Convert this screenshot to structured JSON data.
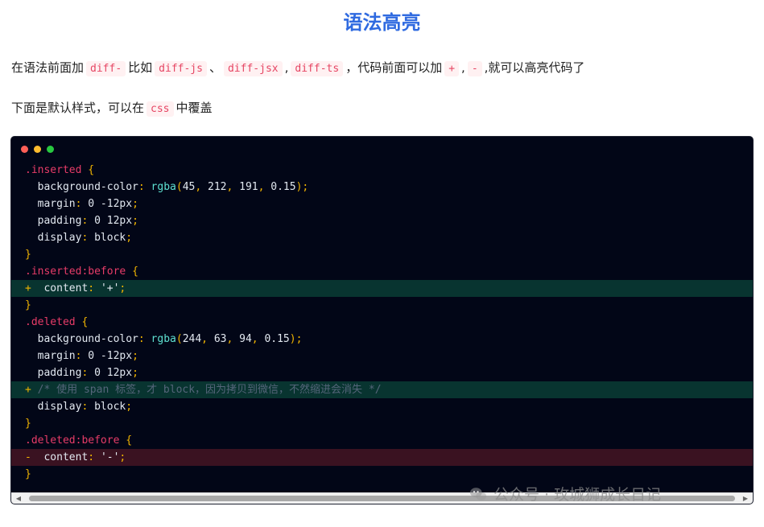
{
  "title": "语法高亮",
  "para1": {
    "t1": "在语法前面加",
    "c1": "diff-",
    "t2": "比如",
    "c2": "diff-js",
    "t3": "、",
    "c3": "diff-jsx",
    "t4": ",",
    "c4": "diff-ts",
    "t5": "，代码前面可以加",
    "c5": "+",
    "t6": ",",
    "c6": "-",
    "t7": ",就可以高亮代码了"
  },
  "para2": {
    "t1": "下面是默认样式，可以在",
    "c1": "css",
    "t2": "中覆盖"
  },
  "code_lines": [
    {
      "type": "normal",
      "segs": [
        {
          "c": "sel",
          "t": ".inserted"
        },
        {
          "c": "",
          "t": " "
        },
        {
          "c": "brace",
          "t": "{"
        }
      ]
    },
    {
      "type": "normal",
      "segs": [
        {
          "c": "",
          "t": "  "
        },
        {
          "c": "prop",
          "t": "background-color"
        },
        {
          "c": "punc",
          "t": ": "
        },
        {
          "c": "func",
          "t": "rgba"
        },
        {
          "c": "punc",
          "t": "("
        },
        {
          "c": "num",
          "t": "45"
        },
        {
          "c": "punc",
          "t": ", "
        },
        {
          "c": "num",
          "t": "212"
        },
        {
          "c": "punc",
          "t": ", "
        },
        {
          "c": "num",
          "t": "191"
        },
        {
          "c": "punc",
          "t": ", "
        },
        {
          "c": "num",
          "t": "0.15"
        },
        {
          "c": "punc",
          "t": ");"
        }
      ]
    },
    {
      "type": "normal",
      "segs": [
        {
          "c": "",
          "t": "  "
        },
        {
          "c": "prop",
          "t": "margin"
        },
        {
          "c": "punc",
          "t": ": "
        },
        {
          "c": "val",
          "t": "0 -12px"
        },
        {
          "c": "punc",
          "t": ";"
        }
      ]
    },
    {
      "type": "normal",
      "segs": [
        {
          "c": "",
          "t": "  "
        },
        {
          "c": "prop",
          "t": "padding"
        },
        {
          "c": "punc",
          "t": ": "
        },
        {
          "c": "val",
          "t": "0 12px"
        },
        {
          "c": "punc",
          "t": ";"
        }
      ]
    },
    {
      "type": "normal",
      "segs": [
        {
          "c": "",
          "t": "  "
        },
        {
          "c": "prop",
          "t": "display"
        },
        {
          "c": "punc",
          "t": ": "
        },
        {
          "c": "val",
          "t": "block"
        },
        {
          "c": "punc",
          "t": ";"
        }
      ]
    },
    {
      "type": "normal",
      "segs": [
        {
          "c": "brace",
          "t": "}"
        }
      ]
    },
    {
      "type": "normal",
      "segs": [
        {
          "c": "sel",
          "t": ".inserted:before"
        },
        {
          "c": "",
          "t": " "
        },
        {
          "c": "brace",
          "t": "{"
        }
      ]
    },
    {
      "type": "ins",
      "segs": [
        {
          "c": "mark",
          "t": "+"
        },
        {
          "c": "",
          "t": "  "
        },
        {
          "c": "prop",
          "t": "content"
        },
        {
          "c": "punc",
          "t": ": "
        },
        {
          "c": "str",
          "t": "'+'"
        },
        {
          "c": "punc",
          "t": ";"
        }
      ]
    },
    {
      "type": "normal",
      "segs": [
        {
          "c": "brace",
          "t": "}"
        }
      ]
    },
    {
      "type": "normal",
      "segs": [
        {
          "c": "sel",
          "t": ".deleted"
        },
        {
          "c": "",
          "t": " "
        },
        {
          "c": "brace",
          "t": "{"
        }
      ]
    },
    {
      "type": "normal",
      "segs": [
        {
          "c": "",
          "t": "  "
        },
        {
          "c": "prop",
          "t": "background-color"
        },
        {
          "c": "punc",
          "t": ": "
        },
        {
          "c": "func",
          "t": "rgba"
        },
        {
          "c": "punc",
          "t": "("
        },
        {
          "c": "num",
          "t": "244"
        },
        {
          "c": "punc",
          "t": ", "
        },
        {
          "c": "num",
          "t": "63"
        },
        {
          "c": "punc",
          "t": ", "
        },
        {
          "c": "num",
          "t": "94"
        },
        {
          "c": "punc",
          "t": ", "
        },
        {
          "c": "num",
          "t": "0.15"
        },
        {
          "c": "punc",
          "t": ");"
        }
      ]
    },
    {
      "type": "normal",
      "segs": [
        {
          "c": "",
          "t": "  "
        },
        {
          "c": "prop",
          "t": "margin"
        },
        {
          "c": "punc",
          "t": ": "
        },
        {
          "c": "val",
          "t": "0 -12px"
        },
        {
          "c": "punc",
          "t": ";"
        }
      ]
    },
    {
      "type": "normal",
      "segs": [
        {
          "c": "",
          "t": "  "
        },
        {
          "c": "prop",
          "t": "padding"
        },
        {
          "c": "punc",
          "t": ": "
        },
        {
          "c": "val",
          "t": "0 12px"
        },
        {
          "c": "punc",
          "t": ";"
        }
      ]
    },
    {
      "type": "ins",
      "segs": [
        {
          "c": "mark",
          "t": "+"
        },
        {
          "c": "",
          "t": " "
        },
        {
          "c": "cmt",
          "t": "/* 使用 span 标签，才 block，因为拷贝到微信，不然缩进会消失 */"
        }
      ]
    },
    {
      "type": "normal",
      "segs": [
        {
          "c": "",
          "t": "  "
        },
        {
          "c": "prop",
          "t": "display"
        },
        {
          "c": "punc",
          "t": ": "
        },
        {
          "c": "val",
          "t": "block"
        },
        {
          "c": "punc",
          "t": ";"
        }
      ]
    },
    {
      "type": "normal",
      "segs": [
        {
          "c": "brace",
          "t": "}"
        }
      ]
    },
    {
      "type": "normal",
      "segs": [
        {
          "c": "sel",
          "t": ".deleted:before"
        },
        {
          "c": "",
          "t": " "
        },
        {
          "c": "brace",
          "t": "{"
        }
      ]
    },
    {
      "type": "del",
      "segs": [
        {
          "c": "mark",
          "t": "-"
        },
        {
          "c": "",
          "t": "  "
        },
        {
          "c": "prop",
          "t": "content"
        },
        {
          "c": "punc",
          "t": ": "
        },
        {
          "c": "str",
          "t": "'-'"
        },
        {
          "c": "punc",
          "t": ";"
        }
      ]
    },
    {
      "type": "normal",
      "segs": [
        {
          "c": "brace",
          "t": "}"
        }
      ]
    }
  ],
  "watermark": "公众号 · 玫城狮成长日记",
  "colors": {
    "title": "#2f6ae0",
    "code_bg": "#020617",
    "inserted_bg": "#083430",
    "deleted_bg": "#3a1221",
    "selector": "#e83c68",
    "brace": "#f0b400",
    "function": "#5ee0d1"
  }
}
